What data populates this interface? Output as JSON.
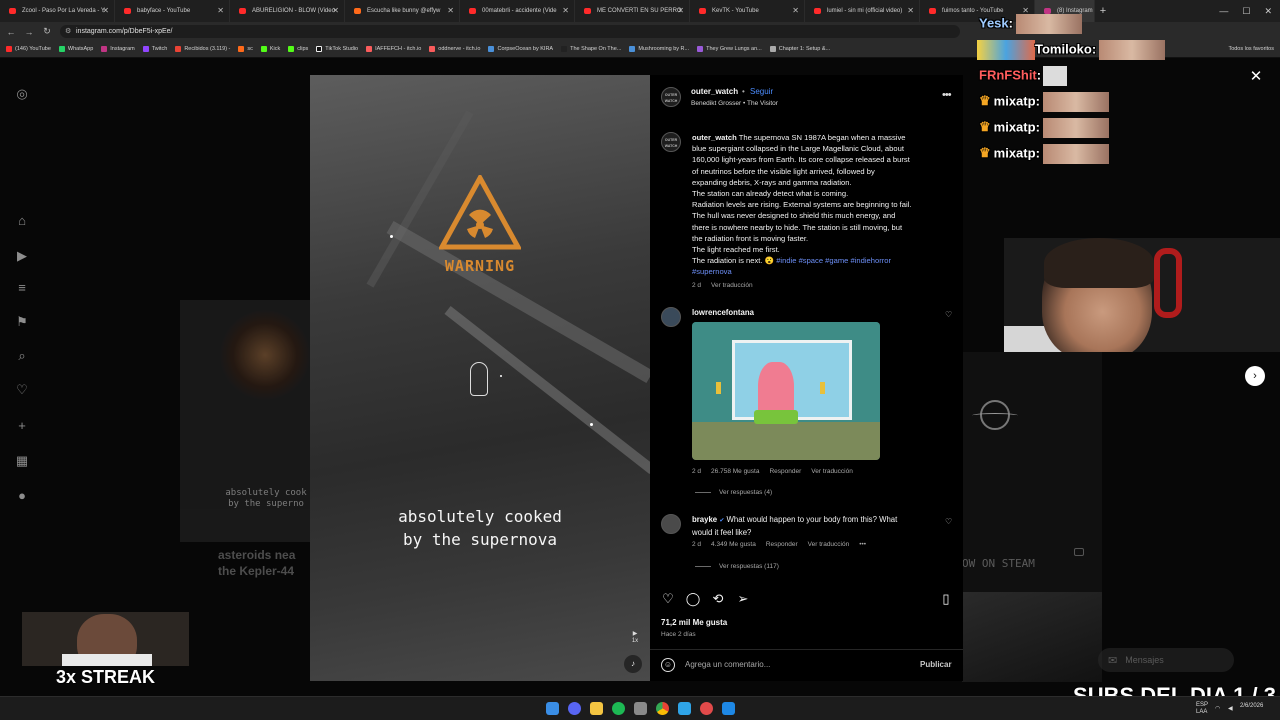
{
  "browser": {
    "tabs": [
      {
        "title": "Zcool - Paso Por La Vereda - Y"
      },
      {
        "title": "babyface - YouTube"
      },
      {
        "title": "ABURELIGION - BLOW (Video"
      },
      {
        "title": "Escucha like bunny @effyw"
      },
      {
        "title": "00matebrli - accidente (Vide"
      },
      {
        "title": "ME CONVERTI EN SU PERRO"
      },
      {
        "title": "KevTK - YouTube"
      },
      {
        "title": "lumiel - sin mi (official video)"
      },
      {
        "title": "fuimos tanto - YouTube"
      },
      {
        "title": "(8) Instagram"
      }
    ],
    "url": "instagram.com/p/DbeF5i-xpEe/",
    "bookmarks": [
      "(146) YouTube",
      "WhatsApp",
      "Instagram",
      "Twitch",
      "Recibidos (3.119) -",
      "sc",
      "Kick",
      "clips",
      "TikTok Studio",
      "IAFFEFCH - itch.io",
      "oddnerve - itch.io",
      "CorpseOcean by KIRA",
      "The Shape On The...",
      "Mushrooming by R...",
      "They Grew Lungs an...",
      "Chapter 1: Setup &..."
    ],
    "bookmarks_all": "Todos los favoritos",
    "colors": {
      "tab_bar": "#1f1f1f",
      "youtube_red": "#ff2a2a"
    }
  },
  "video": {
    "warning_text": "WARNING",
    "caption_line1": "absolutely cooked",
    "caption_line2": "by the supernova",
    "speed_label": "1x",
    "mute_icon": "speaker-icon",
    "warning_color": "#d98a2f"
  },
  "background_posts": {
    "left_caption_line1": "absolutely cook",
    "left_caption_line2": "by the superno",
    "left_title_line1": "asteroids nea",
    "left_title_line2": "the Kepler-44",
    "right_steam": "OW ON STEAM"
  },
  "post": {
    "username": "outer_watch",
    "avatar_text_line1": "OUTER",
    "avatar_text_line2": "WATCH",
    "separator": "•",
    "follow_label": "Seguir",
    "audio": "Benedikt Grosser • The Visitor",
    "caption_username": "outer_watch",
    "caption_line1": "The supernova SN 1987A began when a massive",
    "caption_line2": "blue supergiant collapsed in the Large Magellanic Cloud, about",
    "caption_line3": "160,000 light-years from Earth. Its core collapse released a burst",
    "caption_line4": "of neutrinos before the visible light arrived, followed by",
    "caption_line5": "expanding debris, X-rays and gamma radiation.",
    "caption_line6": "The station can already detect what is coming.",
    "caption_line7": "Radiation levels are rising. External systems are beginning to fail.",
    "caption_line8": "The hull was never designed to shield this much energy, and",
    "caption_line9": "there is nowhere nearby to hide. The station is still moving, but",
    "caption_line10": "the radiation front is moving faster.",
    "caption_line11": "The light reached me first.",
    "caption_line12": "The radiation is next. 😮",
    "tags_line1": "#indie #space #game #indiehorror",
    "tags_line2": "#supernova",
    "caption_age": "2 d",
    "caption_translate": "Ver traducción",
    "comments": [
      {
        "username": "lowrencefontana",
        "age": "2 d",
        "likes": "26.758 Me gusta",
        "reply": "Responder",
        "translate": "Ver traducción",
        "replies": "Ver respuestas (4)"
      },
      {
        "username": "brayke",
        "verified": "✔",
        "text_line1": "What would happen to your body from this? What",
        "text_line2": "would it feel like?",
        "age": "2 d",
        "likes": "4.349 Me gusta",
        "reply": "Responder",
        "translate": "Ver traducción",
        "more": "•••",
        "replies": "Ver respuestas (117)"
      }
    ],
    "like_count": "71,2 mil Me gusta",
    "posted_ago": "Hace 2 días",
    "comment_placeholder": "Agrega un comentario...",
    "publish_label": "Publicar",
    "link_color": "#4c8dff"
  },
  "instagram_ui": {
    "close_icon": "✕",
    "next_icon": "›",
    "messages_label": "Mensajes"
  },
  "stream_overlay": {
    "chat": [
      {
        "user": "Yesk",
        "text": ":"
      },
      {
        "user": "Tomiloko",
        "text": ":"
      },
      {
        "user": "FRnFShit",
        "text": ":"
      },
      {
        "user": "mixatp",
        "text": ":"
      },
      {
        "user": "mixatp",
        "text": ":"
      },
      {
        "user": "mixatp",
        "text": ":"
      }
    ],
    "streak_label": "3x STREAK",
    "subs_label": "SUBS DEL DIA 1 / 3",
    "crown_icon": "♛"
  },
  "taskbar": {
    "lang_line1": "ESP",
    "lang_line2": "LAA",
    "time": "",
    "date": "2/6/2026"
  }
}
